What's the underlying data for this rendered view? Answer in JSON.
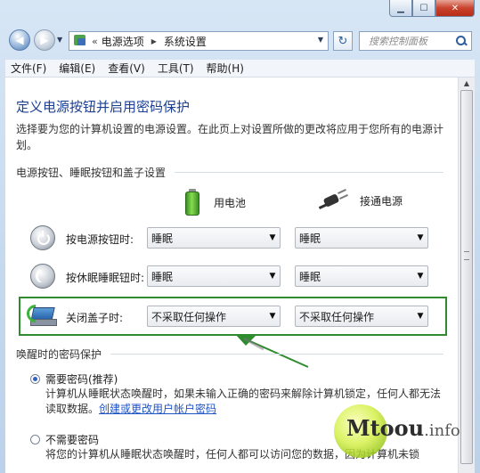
{
  "caption": {
    "minimize_glyph": "▁",
    "maximize_glyph": "☐",
    "close_glyph": "✕"
  },
  "nav": {
    "back_icon": "back-arrow-icon",
    "breadcrumb_prefix": "«",
    "breadcrumbs": [
      "电源选项",
      "系统设置"
    ],
    "search_placeholder": "搜索控制面板"
  },
  "menu": [
    "文件(F)",
    "编辑(E)",
    "查看(V)",
    "工具(T)",
    "帮助(H)"
  ],
  "page": {
    "title": "定义电源按钮并启用密码保护",
    "description": "选择要为您的计算机设置的电源设置。在此页上对设置所做的更改将应用于您所有的电源计划。"
  },
  "buttons_group": {
    "title": "电源按钮、睡眠按钮和盖子设置",
    "columns": {
      "battery": "用电池",
      "plugged": "接通电源"
    },
    "rows": [
      {
        "label": "按电源按钮时:",
        "battery": "睡眠",
        "plugged": "睡眠"
      },
      {
        "label": "按休眠睡眠钮时:",
        "battery": "睡眠",
        "plugged": "睡眠"
      },
      {
        "label": "关闭盖子时:",
        "battery": "不采取任何操作",
        "plugged": "不采取任何操作"
      }
    ]
  },
  "password_group": {
    "title": "唤醒时的密码保护",
    "require": {
      "label": "需要密码(推荐)",
      "desc": "计算机从睡眠状态唤醒时，如果未输入正确的密码来解除计算机锁定，任何人都无法读取数据。",
      "link": "创建或更改用户帐户密码",
      "selected": true
    },
    "no_require": {
      "label": "不需要密码",
      "desc": "将您的计算机从睡眠状态唤醒时，任何人都可以访问您的数据，因为计算机未锁",
      "selected": false
    }
  },
  "watermark": {
    "main": "Mtoou",
    "suffix": ".info"
  },
  "colors": {
    "title": "#1c3f94",
    "link": "#1f54c4",
    "highlight": "#2e8b2e"
  }
}
